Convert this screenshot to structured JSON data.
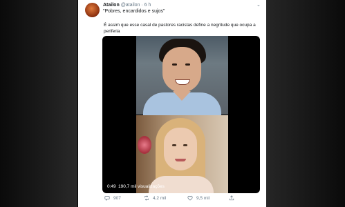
{
  "tweet": {
    "display_name": "Atailon",
    "handle": "@atailon",
    "separator": "·",
    "time": "6 h",
    "quote": "\"Pobres, encardidos e sujos\"",
    "text": "É assim que esse casal de pastores racistas define a negritude que ocupa a periferia"
  },
  "video": {
    "elapsed": "0:49",
    "views": "190,7 mil visualizações"
  },
  "actions": {
    "replies": "907",
    "retweets": "4,2 mil",
    "likes": "9,5 mil"
  },
  "icons": [
    "avatar",
    "chevron-down-icon",
    "reply-icon",
    "retweet-icon",
    "like-icon",
    "share-icon"
  ]
}
